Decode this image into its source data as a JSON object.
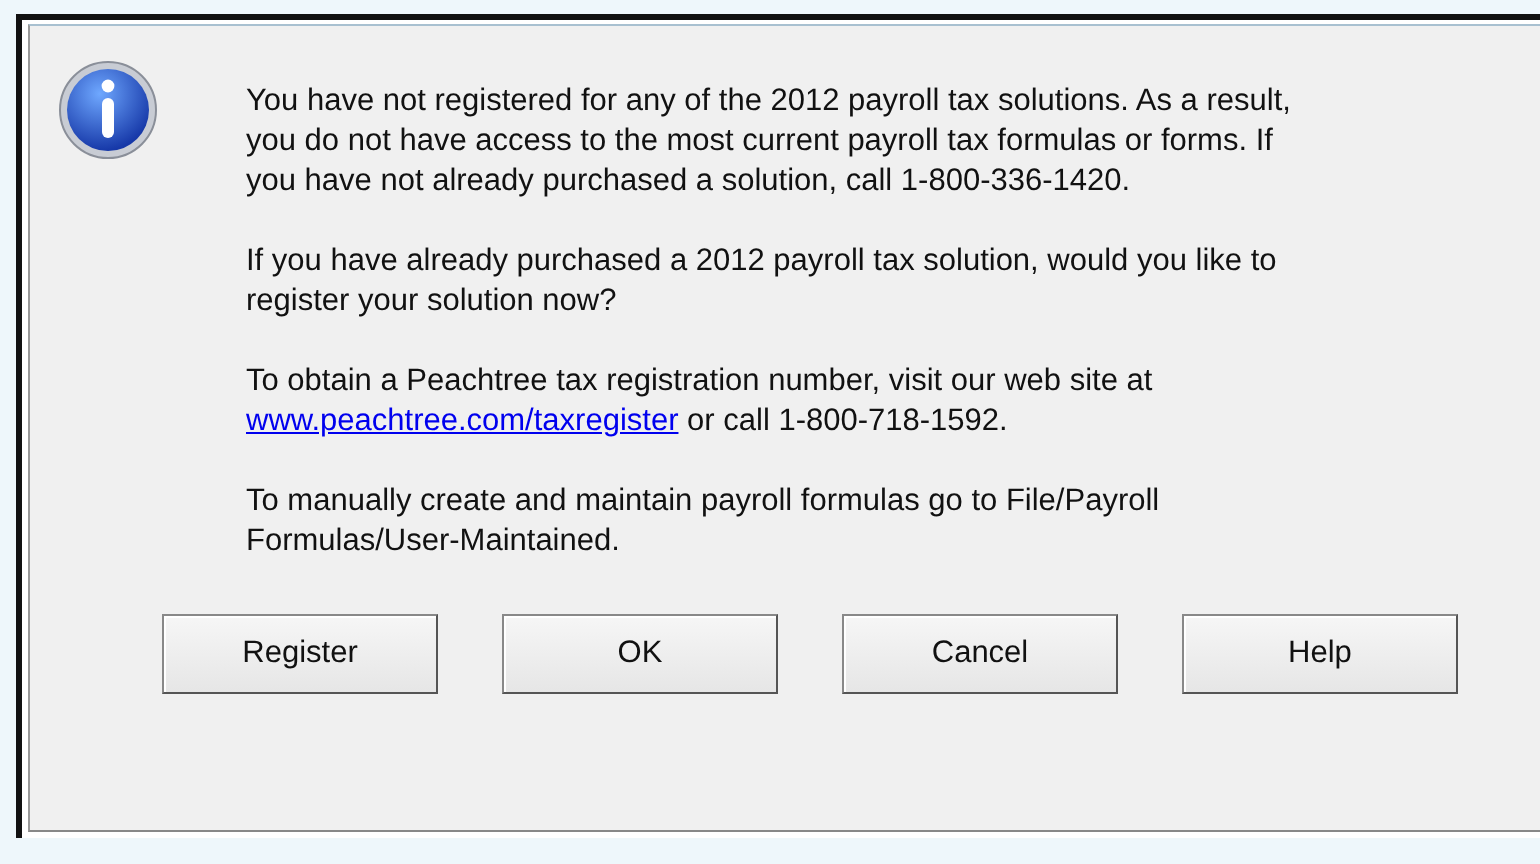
{
  "message": {
    "paragraphs": [
      {
        "lines": [
          [
            {
              "text": "You have not registered for any of the 2012 payroll tax solutions. As a result,"
            }
          ],
          [
            {
              "text": "you do not have access to the most current payroll tax formulas or forms. If"
            }
          ],
          [
            {
              "text": "you have not already purchased a solution, call 1-800-336-1420."
            }
          ]
        ]
      },
      {
        "lines": [
          [
            {
              "text": "If you have already purchased a 2012 payroll tax solution, would you like to"
            }
          ],
          [
            {
              "text": "register your solution now?"
            }
          ]
        ]
      },
      {
        "lines": [
          [
            {
              "text": "To obtain a Peachtree tax registration number, visit our web site at"
            }
          ],
          [
            {
              "text": "www.peachtree.com/taxregister",
              "kind": "link"
            },
            {
              "text": " or call 1-800-718-1592."
            }
          ]
        ]
      },
      {
        "lines": [
          [
            {
              "text": "To manually create and maintain payroll formulas go to File/Payroll"
            }
          ],
          [
            {
              "text": "Formulas/User-Maintained."
            }
          ]
        ]
      }
    ]
  },
  "buttons": [
    "Register",
    "OK",
    "Cancel",
    "Help"
  ]
}
